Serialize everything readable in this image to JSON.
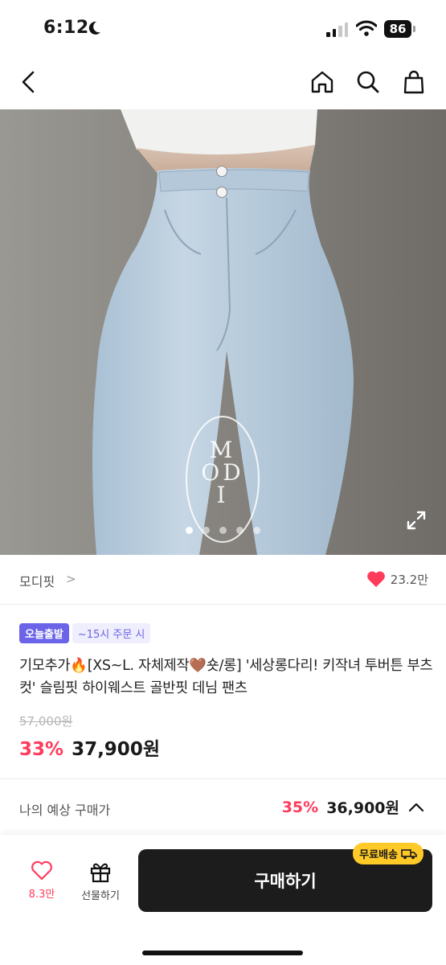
{
  "status_bar": {
    "time": "6:12",
    "battery": "86"
  },
  "nav": {
    "back_icon": "chevron-left-icon",
    "home_icon": "home-icon",
    "search_icon": "search-icon",
    "cart_icon": "shopping-bag-icon"
  },
  "image": {
    "watermark": "MODI",
    "slide_count": 5,
    "active_slide": 1
  },
  "brand": {
    "name": "모디핏",
    "chevron": ">",
    "likes": "23.2만"
  },
  "badges": {
    "today": "오늘출발",
    "cutoff": "~15시 주문 시"
  },
  "product": {
    "title": "기모추가🔥[XS~L. 자체제작🤎숏/롱] '세상롱다리! 키작녀 투버튼 부츠컷' 슬림핏 하이웨스트 골반핏 데님 팬츠",
    "original_price": "57,000원",
    "discount": "33%",
    "price": "37,900원"
  },
  "expected": {
    "label": "나의 예상 구매가",
    "discount": "35%",
    "price": "36,900원"
  },
  "bottom_bar": {
    "like_count": "8.3만",
    "gift_label": "선물하기",
    "buy_label": "구매하기",
    "free_shipping": "무료배송"
  },
  "colors": {
    "accent_pink": "#ff3b5c",
    "badge_purple": "#6b63e8",
    "buy_button": "#1c1c1c",
    "free_ship_yellow": "#ffc928"
  }
}
